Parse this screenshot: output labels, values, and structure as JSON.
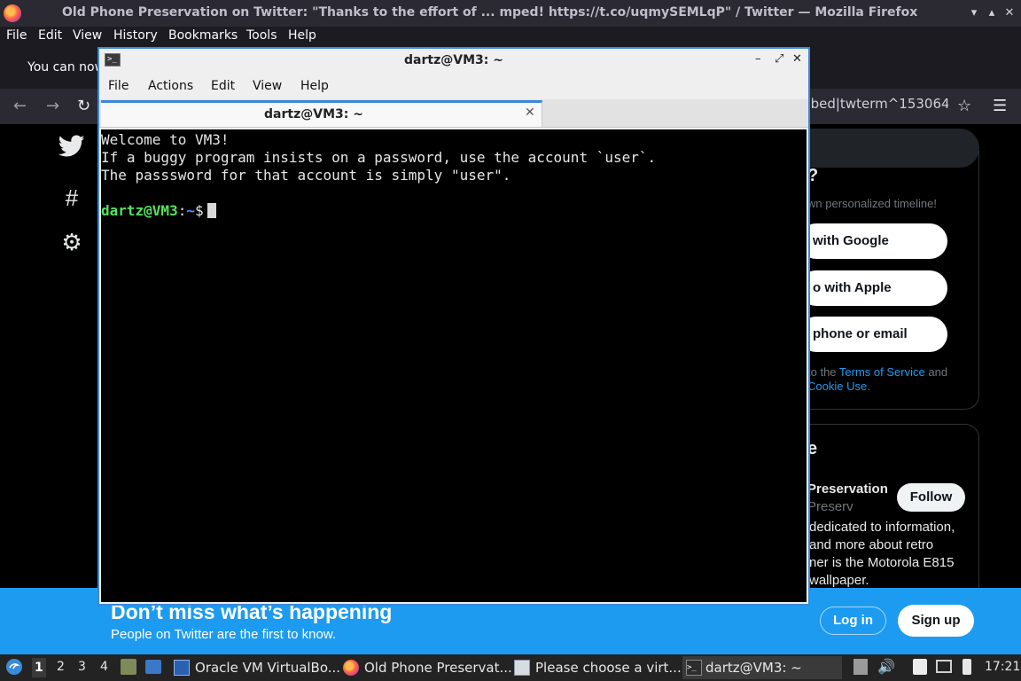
{
  "firefox": {
    "window_title": "Old Phone Preservation on Twitter: \"Thanks to the effort of ...  mped! https://t.co/uqmySEMLqP\" / Twitter — Mozilla Firefox",
    "menu": [
      "File",
      "Edit",
      "View",
      "History",
      "Bookmarks",
      "Tools",
      "Help"
    ],
    "notification_text": "You can now",
    "url_fragment": "mbed|twterm^153064"
  },
  "twitter": {
    "login_panel": {
      "heading": "?",
      "subtitle": "wn personalized timeline!",
      "google": "with Google",
      "apple": "o with Apple",
      "phone": "phone or email",
      "tos_prefix": "to the",
      "tos_link": "Terms of Service",
      "tos_and": "and",
      "cookie_link": "Cookie Use."
    },
    "who_panel": {
      "heading": "e",
      "name": "Preservation",
      "handle": "Preserv",
      "follow": "Follow",
      "bio": "dedicated to information, and more about retro\nner is the Motorola E815\nwallpaper."
    },
    "banner": {
      "heading": "Don’t miss what’s happening",
      "subtext": "People on Twitter are the first to know.",
      "login": "Log in",
      "signup": "Sign up"
    }
  },
  "terminal": {
    "title": "dartz@VM3: ~",
    "menu": [
      "File",
      "Actions",
      "Edit",
      "View",
      "Help"
    ],
    "tab_title": "dartz@VM3: ~",
    "lines": [
      "Welcome to VM3!",
      "If a buggy program insists on a password, use the account `user`.",
      "The passsword for that account is simply \"user\"."
    ],
    "prompt_user": "dartz@VM3",
    "prompt_sep": ":",
    "prompt_dir": "~",
    "prompt_sign": "$"
  },
  "taskbar": {
    "workspaces": [
      "1",
      "2",
      "3",
      "4"
    ],
    "tasks": [
      {
        "label": "Oracle VM VirtualBo..."
      },
      {
        "label": "Old Phone Preservat..."
      },
      {
        "label": "Please choose a virt..."
      },
      {
        "label": "dartz@VM3: ~"
      }
    ],
    "clock": "17:21"
  }
}
